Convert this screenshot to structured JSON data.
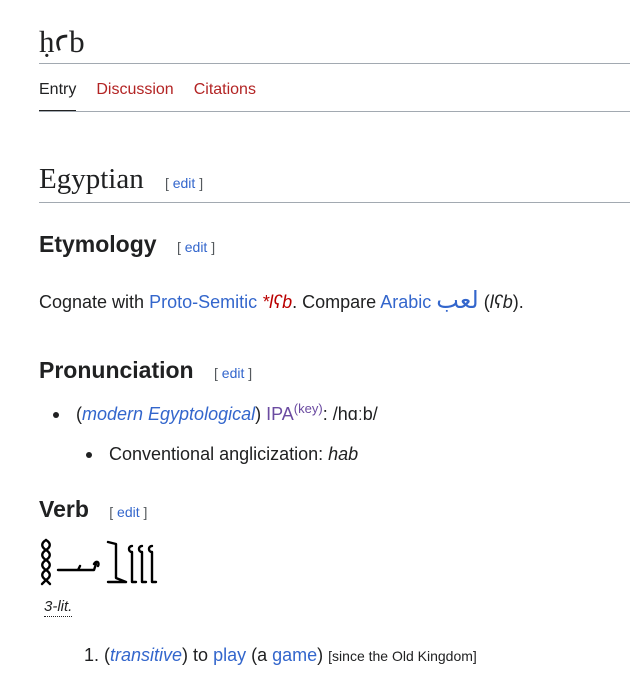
{
  "page": {
    "title": "ḥꜥb"
  },
  "tabs": [
    {
      "label": "Entry",
      "active": true
    },
    {
      "label": "Discussion",
      "active": false
    },
    {
      "label": "Citations",
      "active": false
    }
  ],
  "edit_label": "edit",
  "language": {
    "heading": "Egyptian"
  },
  "etymology": {
    "heading": "Etymology",
    "prefix": "Cognate with",
    "proto_link": "Proto-Semitic",
    "proto_form": "*lʕb",
    "compare": ". Compare",
    "arabic_link": "Arabic",
    "arabic_word": "لعب",
    "translit": "lʕb",
    "open_paren": " (",
    "close_paren": ")."
  },
  "pronunciation": {
    "heading": "Pronunciation",
    "qualifier": "modern Egyptological",
    "ipa_label": "IPA",
    "key_label": "key",
    "ipa_value": ": /hɑːb/",
    "anglicization_label": "Conventional anglicization:",
    "anglicization_value": "hab"
  },
  "verb": {
    "heading": "Verb",
    "class_label": "3-lit.",
    "senses": [
      {
        "number": "1.",
        "qualifier": "transitive",
        "to": " to ",
        "verb_link": "play",
        "paren_open": " (a ",
        "object_link": "game",
        "paren_close": ")",
        "note": "[since the Old Kingdom]"
      }
    ]
  },
  "colors": {
    "link": "#3366cc",
    "redlink": "#ba0000",
    "tab_inactive": "#b32424",
    "ipa_visited": "#6b4ba1",
    "rule": "#a2a9b1"
  }
}
